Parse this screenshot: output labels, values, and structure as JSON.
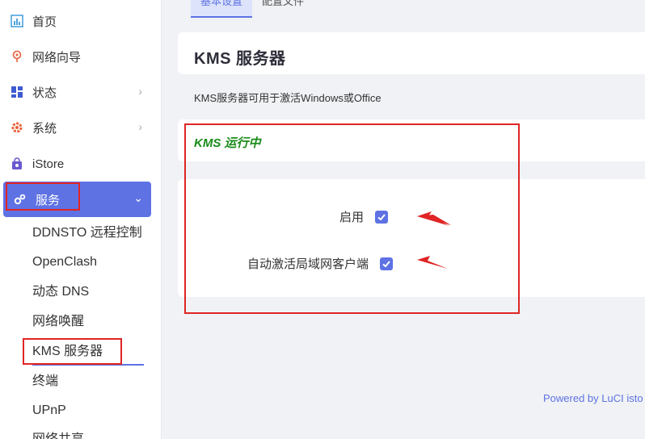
{
  "sidebar": {
    "items": [
      {
        "label": "首页",
        "icon": "bar-chart-icon"
      },
      {
        "label": "网络向导",
        "icon": "location-pin-icon"
      },
      {
        "label": "状态",
        "icon": "dashboard-grid-icon"
      },
      {
        "label": "系统",
        "icon": "gear-icon"
      },
      {
        "label": "iStore",
        "icon": "shopping-bag-icon"
      },
      {
        "label": "服务",
        "icon": "cogs-icon"
      }
    ],
    "sub_items": [
      {
        "label": "DDNSTO 远程控制"
      },
      {
        "label": "OpenClash"
      },
      {
        "label": "动态 DNS"
      },
      {
        "label": "网络唤醒"
      },
      {
        "label": "KMS 服务器"
      },
      {
        "label": "终端"
      },
      {
        "label": "UPnP"
      },
      {
        "label": "网络共享"
      }
    ]
  },
  "tabs": [
    {
      "label": "基本设置"
    },
    {
      "label": "配置文件"
    }
  ],
  "page": {
    "title": "KMS 服务器",
    "description": "KMS服务器可用于激活Windows或Office",
    "status": "KMS 运行中"
  },
  "form": {
    "enable_label": "启用",
    "enable_checked": true,
    "auto_activate_label": "自动激活局域网客户端",
    "auto_activate_checked": true
  },
  "footer": {
    "text": "Powered by LuCI isto"
  },
  "colors": {
    "accent": "#5e72e4",
    "status_green": "#1a8c1a",
    "annotation_red": "#e02424"
  }
}
